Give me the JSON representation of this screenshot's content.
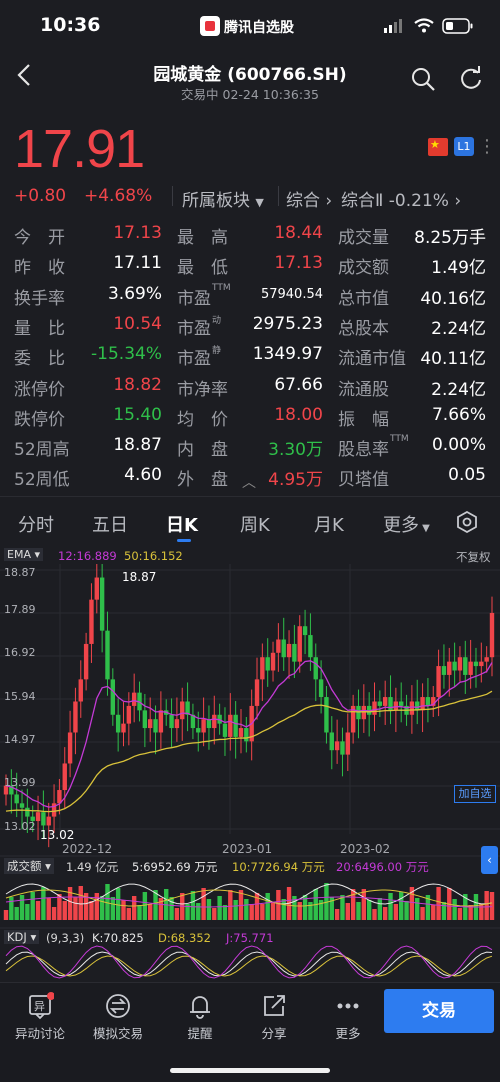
{
  "status": {
    "time": "10:36",
    "app_name": "腾讯自选股"
  },
  "header": {
    "title": "园城黄金 (600766.SH)",
    "subtitle": "交易中 02-24 10:36:35"
  },
  "price": {
    "last": "17.91",
    "change": "+0.80",
    "change_pct": "+4.68%",
    "sector_label": "所属板块",
    "composite_label": "综合",
    "composite_ii": "综合Ⅱ -0.21%",
    "l1_badge": "L1"
  },
  "quote": {
    "col1": [
      {
        "label": "今　开",
        "value": "17.13",
        "color": "red"
      },
      {
        "label": "昨　收",
        "value": "17.11",
        "color": "white"
      },
      {
        "label": "换手率",
        "value": "3.69%",
        "color": "white"
      },
      {
        "label": "量　比",
        "value": "10.54",
        "color": "red"
      },
      {
        "label": "委　比",
        "value": "-15.34%",
        "color": "green"
      },
      {
        "label": "涨停价",
        "value": "18.82",
        "color": "red"
      },
      {
        "label": "跌停价",
        "value": "15.40",
        "color": "green"
      },
      {
        "label": "52周高",
        "value": "18.87",
        "color": "white"
      },
      {
        "label": "52周低",
        "value": "4.60",
        "color": "white"
      }
    ],
    "col2": [
      {
        "label": "最　高",
        "value": "18.44",
        "color": "red"
      },
      {
        "label": "最　低",
        "value": "17.13",
        "color": "red"
      },
      {
        "label": "市盈",
        "sup": "TTM",
        "value": "57940.54",
        "color": "white"
      },
      {
        "label": "市盈",
        "sup": "动",
        "value": "2975.23",
        "color": "white"
      },
      {
        "label": "市盈",
        "sup": "静",
        "value": "1349.97",
        "color": "white"
      },
      {
        "label": "市净率",
        "value": "67.66",
        "color": "white"
      },
      {
        "label": "均　价",
        "value": "18.00",
        "color": "red"
      },
      {
        "label": "内　盘",
        "value": "3.30万",
        "color": "green"
      },
      {
        "label": "外　盘",
        "value": "4.95万",
        "color": "red"
      }
    ],
    "col3": [
      {
        "label": "成交量",
        "value": "8.25万手"
      },
      {
        "label": "成交额",
        "value": "1.49亿"
      },
      {
        "label": "总市值",
        "value": "40.16亿"
      },
      {
        "label": "总股本",
        "value": "2.24亿"
      },
      {
        "label": "流通市值",
        "value": "40.11亿"
      },
      {
        "label": "流通股",
        "value": "2.24亿"
      },
      {
        "label": "振　幅",
        "value": "7.66%"
      },
      {
        "label": "股息率",
        "sup": "TTM",
        "value": "0.00%"
      },
      {
        "label": "贝塔值",
        "value": "0.05"
      }
    ]
  },
  "tabs": [
    "分时",
    "五日",
    "日K",
    "周K",
    "月K",
    "更多"
  ],
  "active_tab": "日K",
  "chart": {
    "ema_label": "EMA",
    "ema12": "12:16.889",
    "ema50": "50:16.152",
    "restore": "不复权",
    "y_ticks": [
      "18.87",
      "17.89",
      "16.92",
      "15.94",
      "14.97",
      "13.99",
      "13.02"
    ],
    "x_ticks": [
      "2022-12",
      "2023-01",
      "2023-02"
    ],
    "high_mark": "18.87",
    "low_mark": "13.02",
    "add_watch": "加自选",
    "volume_label": "成交额",
    "volume_value": "1.49 亿元",
    "vol5": "5:6952.69 万元",
    "vol10": "10:7726.94 万元",
    "vol20": "20:6496.00 万元",
    "kdj_label": "KDJ",
    "kdj_params": "(9,3,3)",
    "kdj_k": "K:70.825",
    "kdj_d": "D:68.352",
    "kdj_j": "J:75.771",
    "colors": {
      "up": "#f0454a",
      "down": "#2fbf4a",
      "ema12": "#c43ad6",
      "ema50": "#d9c23a"
    }
  },
  "nav": [
    {
      "label": "异动讨论",
      "icon": "discussion-icon"
    },
    {
      "label": "模拟交易",
      "icon": "simulate-trade-icon"
    },
    {
      "label": "提醒",
      "icon": "bell-icon"
    },
    {
      "label": "分享",
      "icon": "share-icon"
    },
    {
      "label": "更多",
      "icon": "more-dots-icon"
    }
  ],
  "trade_button": "交易"
}
